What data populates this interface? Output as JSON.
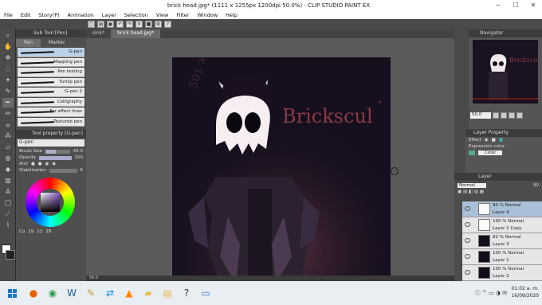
{
  "window": {
    "title": "brick head.jpg* (1111 x 1255px 1200dpi 50.0%) - CLIP STUDIO PAINT EX",
    "minimize": "─",
    "maximize": "☐",
    "close": "✕"
  },
  "menu": [
    "File",
    "Edit",
    "Story(P)",
    "Animation",
    "Layer",
    "Selection",
    "View",
    "Filter",
    "Window",
    "Help"
  ],
  "subtool": {
    "header": "Sub Tool [Pen]",
    "tabs": [
      "Pen",
      "Marker"
    ],
    "brushes": [
      "G-pen",
      "Mapping pen",
      "Pen testing",
      "Turnip pen",
      "G-pen 2",
      "Calligraphy",
      "For effect lines",
      "Textured pen"
    ]
  },
  "toolprop": {
    "header": "Tool property [G-pen]",
    "brush_name": "G-pen",
    "brush_size_label": "Brush Size",
    "brush_size_value": "43.0",
    "brush_size_level": 0.43,
    "opacity_label": "Opacity",
    "opacity_value": "100",
    "opacity_level": 1.0,
    "aa_label": "Anti",
    "stab_label": "Stabilization",
    "stab_value": "6"
  },
  "color": {
    "fg": "#ffffff",
    "wheel_label": "Co",
    "values": [
      "19",
      "13",
      "28"
    ],
    "accent": "#8855cc"
  },
  "doc_tabs": [
    "sink*",
    "brick head.jpg*"
  ],
  "canvas": {
    "signature": "Brickscul",
    "signature_mark": "°",
    "bg": "#160f1e",
    "text_color": "#8a3a4a"
  },
  "status": {
    "zoom": "50.0"
  },
  "navigator": {
    "header": "Navigator",
    "zoom": "50.0",
    "rotate": "0.0"
  },
  "layer_property": {
    "header": "Layer Property",
    "effect_label": "Effect",
    "expression_label": "Expression color",
    "color_value": "Color"
  },
  "layer_panel": {
    "header": "Layer",
    "blend": "Normal",
    "opacity": "90",
    "layers": [
      {
        "pct": "90 %",
        "mode": "Normal",
        "name": "Layer 4",
        "white": true,
        "selected": true
      },
      {
        "pct": "100 %",
        "mode": "Normal",
        "name": "Layer 1 Copy",
        "white": true,
        "selected": false
      },
      {
        "pct": "82 %",
        "mode": "Normal",
        "name": "Layer 3",
        "white": false,
        "selected": false
      },
      {
        "pct": "100 %",
        "mode": "Normal",
        "name": "Layer 1",
        "white": false,
        "selected": false
      },
      {
        "pct": "100 %",
        "mode": "Normal",
        "name": "Layer 2",
        "white": false,
        "selected": false
      }
    ]
  },
  "taskbar": {
    "time": "01:02 a. m.",
    "date": "16/09/2020",
    "apps": [
      "firefox-icon",
      "chrome-icon",
      "word-icon",
      "paint-icon",
      "teamviewer-icon",
      "vlc-icon",
      "files-icon",
      "explorer-icon",
      "clipstudio-icon",
      "window-icon"
    ]
  }
}
